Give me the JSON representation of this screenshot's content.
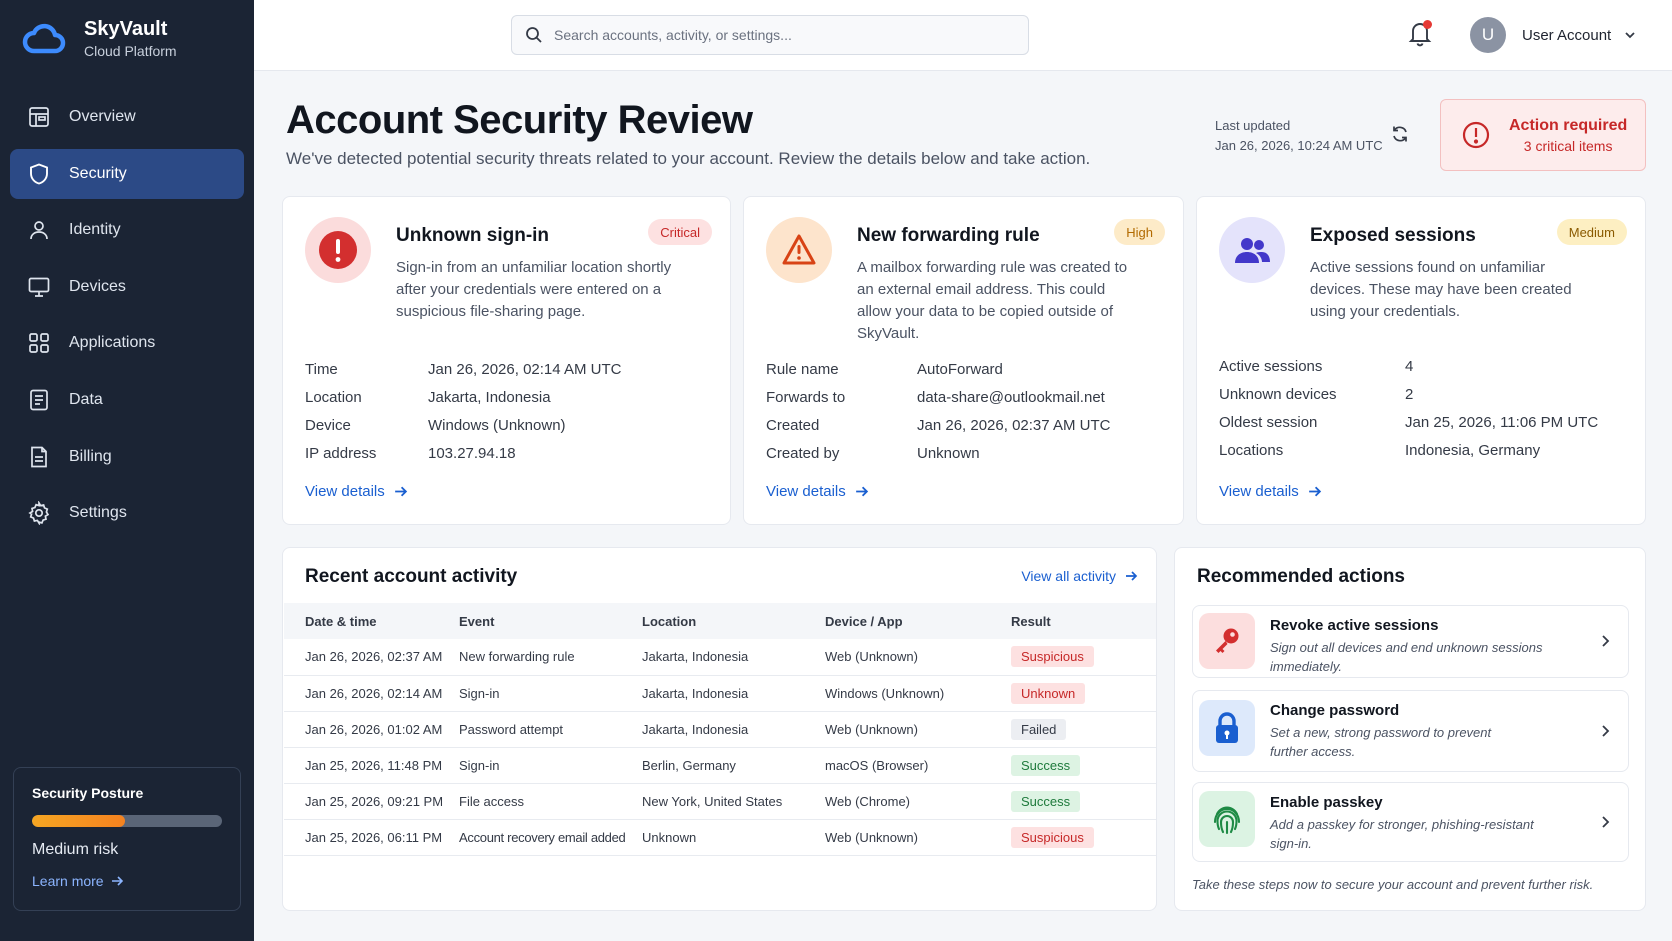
{
  "brand": {
    "name": "SkyVault",
    "subtitle": "Cloud Platform"
  },
  "nav": [
    {
      "label": "Overview",
      "icon": "overview-icon"
    },
    {
      "label": "Security",
      "icon": "shield-icon",
      "active": true
    },
    {
      "label": "Identity",
      "icon": "person-icon"
    },
    {
      "label": "Devices",
      "icon": "monitor-icon"
    },
    {
      "label": "Applications",
      "icon": "grid-icon"
    },
    {
      "label": "Data",
      "icon": "document-icon"
    },
    {
      "label": "Billing",
      "icon": "file-icon"
    },
    {
      "label": "Settings",
      "icon": "gear-icon"
    }
  ],
  "posture": {
    "title": "Security Posture",
    "level": "Medium risk",
    "level_fraction": 0.49,
    "link": "Learn more"
  },
  "search": {
    "placeholder": "Search accounts, activity, or settings..."
  },
  "user": {
    "initial": "U",
    "name": "User Account"
  },
  "header": {
    "title": "Account Security Review",
    "description": "We've detected potential security threats related to your account. Review the details below and take action.",
    "updated_label": "Last updated",
    "updated_value": "Jan 26, 2026, 10:24 AM UTC",
    "action_title": "Action required",
    "action_sub": "3 critical items"
  },
  "threats": [
    {
      "title": "Unknown sign-in",
      "badge": "Critical",
      "description": "Sign-in from an unfamiliar location shortly after your credentials were entered on a suspicious file-sharing page.",
      "fields": [
        {
          "k": "Time",
          "v": "Jan 26, 2026, 02:14 AM UTC"
        },
        {
          "k": "Location",
          "v": "Jakarta, Indonesia"
        },
        {
          "k": "Device",
          "v": "Windows (Unknown)"
        },
        {
          "k": "IP address",
          "v": "103.27.94.18"
        }
      ],
      "link": "View details"
    },
    {
      "title": "New forwarding rule",
      "badge": "High",
      "description": "A mailbox forwarding rule was created to an external email address. This could allow your data to be copied outside of SkyVault.",
      "fields": [
        {
          "k": "Rule name",
          "v": "AutoForward"
        },
        {
          "k": "Forwards to",
          "v": "data-share@outlookmail.net"
        },
        {
          "k": "Created",
          "v": "Jan 26, 2026, 02:37 AM UTC"
        },
        {
          "k": "Created by",
          "v": "Unknown"
        }
      ],
      "link": "View details"
    },
    {
      "title": "Exposed sessions",
      "badge": "Medium",
      "description": "Active sessions found on unfamiliar devices. These may have been created using your credentials.",
      "fields": [
        {
          "k": "Active sessions",
          "v": "4"
        },
        {
          "k": "Unknown devices",
          "v": "2"
        },
        {
          "k": "Oldest session",
          "v": "Jan 25, 2026, 11:06 PM UTC"
        },
        {
          "k": "Locations",
          "v": "Indonesia, Germany"
        }
      ],
      "link": "View details"
    }
  ],
  "activity": {
    "title": "Recent account activity",
    "view_all": "View all activity",
    "columns": [
      "Date & time",
      "Event",
      "Location",
      "Device / App",
      "Result"
    ],
    "rows": [
      [
        "Jan 26, 2026, 02:37 AM",
        "New forwarding rule",
        "Jakarta, Indonesia",
        "Web (Unknown)",
        "Suspicious"
      ],
      [
        "Jan 26, 2026, 02:14 AM",
        "Sign-in",
        "Jakarta, Indonesia",
        "Windows (Unknown)",
        "Unknown"
      ],
      [
        "Jan 26, 2026, 01:02 AM",
        "Password attempt",
        "Jakarta, Indonesia",
        "Web (Unknown)",
        "Failed"
      ],
      [
        "Jan 25, 2026, 11:48 PM",
        "Sign-in",
        "Berlin, Germany",
        "macOS (Browser)",
        "Success"
      ],
      [
        "Jan 25, 2026, 09:21 PM",
        "File access",
        "New York, United States",
        "Web (Chrome)",
        "Success"
      ],
      [
        "Jan 25, 2026, 06:11 PM",
        "Account recovery email added",
        "Unknown",
        "Web (Unknown)",
        "Suspicious"
      ]
    ]
  },
  "recommended": {
    "title": "Recommended actions",
    "items": [
      {
        "title": "Revoke active sessions",
        "description": "Sign out all devices and end unknown sessions immediately.",
        "icon": "key-icon"
      },
      {
        "title": "Change password",
        "description": "Set a new, strong password to prevent further access.",
        "icon": "lock-icon"
      },
      {
        "title": "Enable passkey",
        "description": "Add a passkey for stronger, phishing-resistant sign-in.",
        "icon": "fingerprint-icon"
      }
    ],
    "footer": "Take these steps now to secure your account and prevent further risk."
  },
  "colors": {
    "sidebar_bg": "#1b2434",
    "nav_active": "#2c4a86",
    "link": "#1a5fd0",
    "critical": "#c62828",
    "high": "#b8860b",
    "medium": "#9a6a00",
    "success": "#1e7a3c"
  }
}
